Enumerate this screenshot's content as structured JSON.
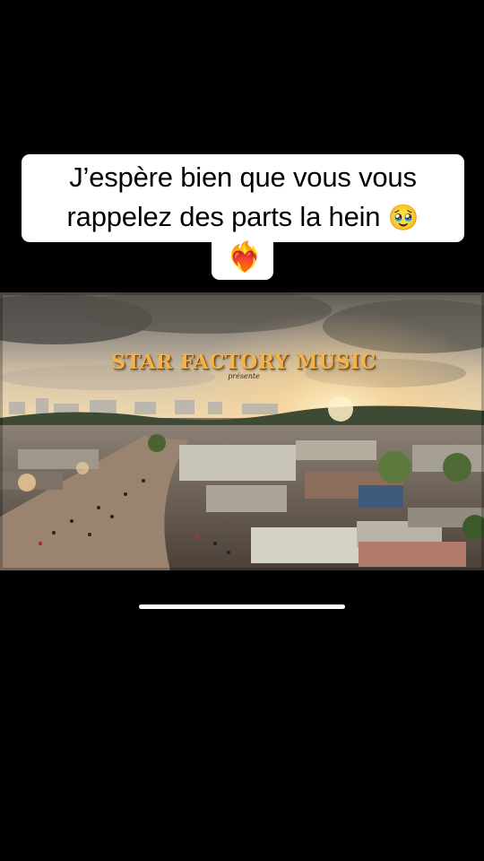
{
  "caption": {
    "line1": "J’espère bien que vous vous",
    "line2": "rappelez des parts la hein",
    "face_emoji": "🥹",
    "heart_emoji": "❤️‍🔥"
  },
  "video": {
    "title": "STAR FACTORY MUSIC",
    "subtitle": "présente"
  },
  "colors": {
    "background": "#000000",
    "caption_bg": "#ffffff",
    "title": "#f3b24a"
  }
}
